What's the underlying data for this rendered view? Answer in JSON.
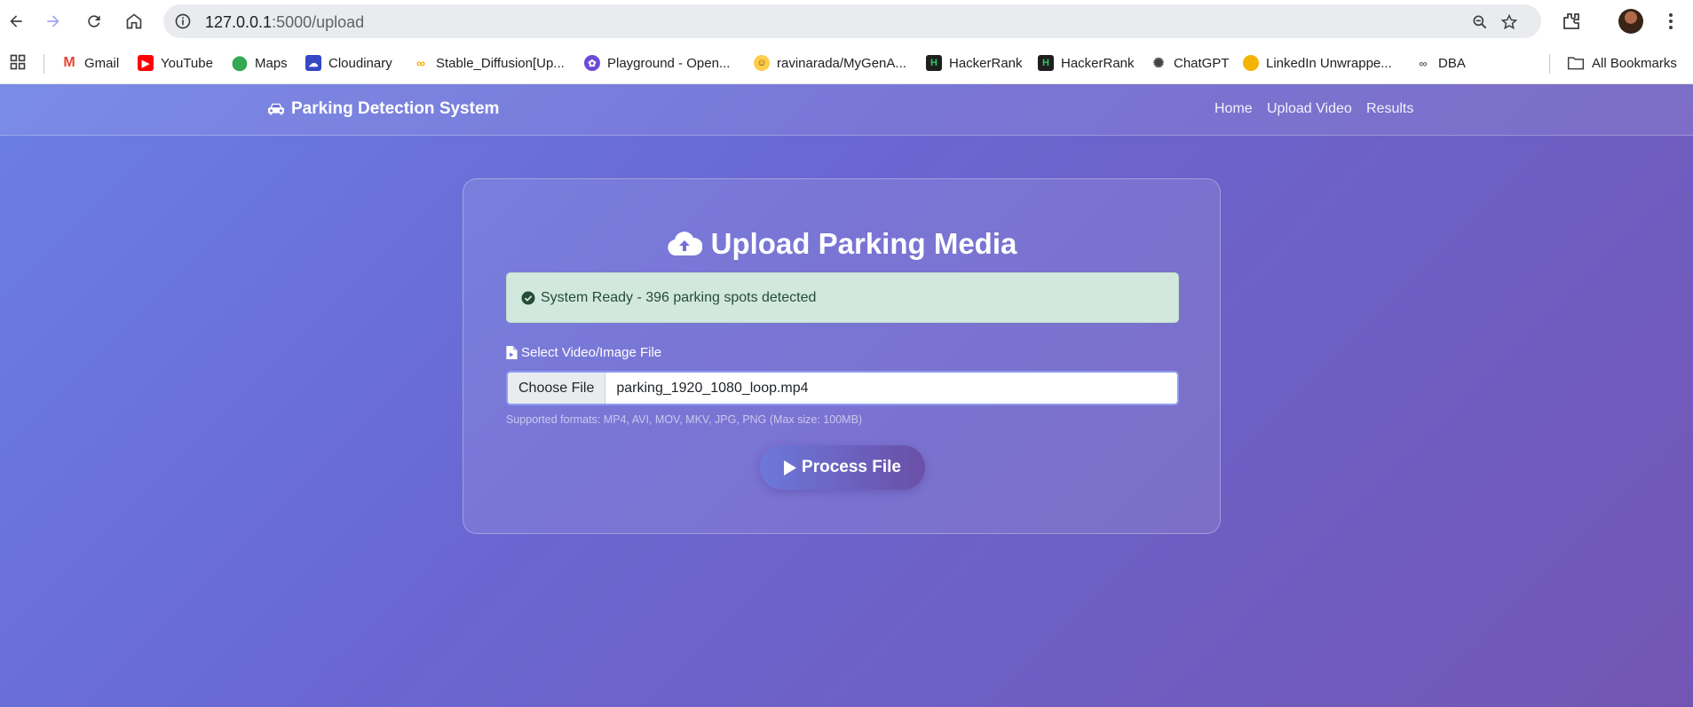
{
  "browser": {
    "url_host": "127.0.0.1",
    "url_path": ":5000/upload",
    "bookmarks": [
      {
        "label": "Gmail",
        "icon": "gmail-icon",
        "color": "#ea4335"
      },
      {
        "label": "YouTube",
        "icon": "youtube-icon",
        "color": "#ff0000"
      },
      {
        "label": "Maps",
        "icon": "maps-icon",
        "color": "#34a853"
      },
      {
        "label": "Cloudinary",
        "icon": "cloudinary-icon",
        "color": "#3448c5"
      },
      {
        "label": "Stable_Diffusion[Up...",
        "icon": "colab-icon",
        "color": "#f9ab00"
      },
      {
        "label": "Playground - Open...",
        "icon": "openai-icon",
        "color": "#6e4ad8"
      },
      {
        "label": "ravinarada/MyGenA...",
        "icon": "huggingface-icon",
        "color": "#ffcc4d"
      },
      {
        "label": "HackerRank",
        "icon": "hackerrank-icon",
        "color": "#1f1f1f"
      },
      {
        "label": "HackerRank",
        "icon": "hackerrank-icon",
        "color": "#1f1f1f"
      },
      {
        "label": "ChatGPT",
        "icon": "chatgpt-icon",
        "color": "#444444"
      },
      {
        "label": "LinkedIn Unwrappe...",
        "icon": "pacman-icon",
        "color": "#f4b400"
      },
      {
        "label": "DBA",
        "icon": "dba-icon",
        "color": "#666666"
      }
    ],
    "all_bookmarks": "All Bookmarks"
  },
  "site": {
    "brand": "Parking Detection System",
    "nav": [
      "Home",
      "Upload Video",
      "Results"
    ]
  },
  "upload": {
    "title": "Upload Parking Media",
    "status": "System Ready - 396 parking spots detected",
    "field_label": "Select Video/Image File",
    "choose_label": "Choose File",
    "file_name": "parking_1920_1080_loop.mp4",
    "help": "Supported formats: MP4, AVI, MOV, MKV, JPG, PNG (Max size: 100MB)",
    "submit": "Process File"
  }
}
